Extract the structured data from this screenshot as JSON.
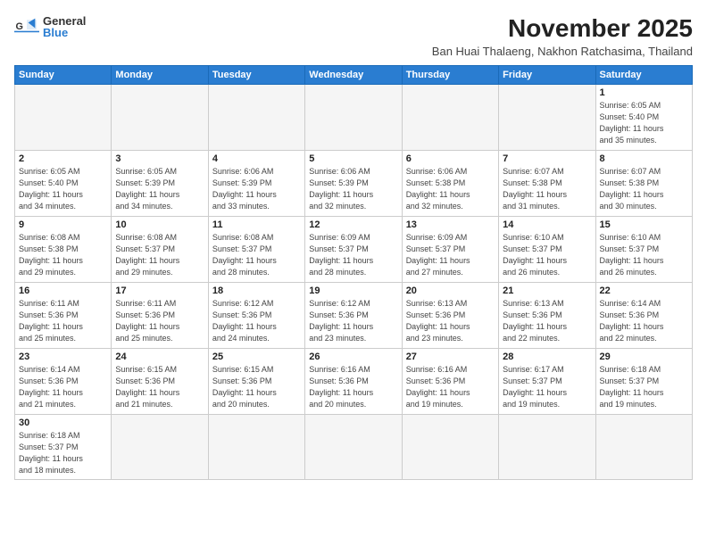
{
  "header": {
    "logo_general": "General",
    "logo_blue": "Blue",
    "month_title": "November 2025",
    "location": "Ban Huai Thalaeng, Nakhon Ratchasima, Thailand"
  },
  "days_of_week": [
    "Sunday",
    "Monday",
    "Tuesday",
    "Wednesday",
    "Thursday",
    "Friday",
    "Saturday"
  ],
  "weeks": [
    [
      {
        "day": "",
        "info": ""
      },
      {
        "day": "",
        "info": ""
      },
      {
        "day": "",
        "info": ""
      },
      {
        "day": "",
        "info": ""
      },
      {
        "day": "",
        "info": ""
      },
      {
        "day": "",
        "info": ""
      },
      {
        "day": "1",
        "info": "Sunrise: 6:05 AM\nSunset: 5:40 PM\nDaylight: 11 hours\nand 35 minutes."
      }
    ],
    [
      {
        "day": "2",
        "info": "Sunrise: 6:05 AM\nSunset: 5:40 PM\nDaylight: 11 hours\nand 34 minutes."
      },
      {
        "day": "3",
        "info": "Sunrise: 6:05 AM\nSunset: 5:39 PM\nDaylight: 11 hours\nand 34 minutes."
      },
      {
        "day": "4",
        "info": "Sunrise: 6:06 AM\nSunset: 5:39 PM\nDaylight: 11 hours\nand 33 minutes."
      },
      {
        "day": "5",
        "info": "Sunrise: 6:06 AM\nSunset: 5:39 PM\nDaylight: 11 hours\nand 32 minutes."
      },
      {
        "day": "6",
        "info": "Sunrise: 6:06 AM\nSunset: 5:38 PM\nDaylight: 11 hours\nand 32 minutes."
      },
      {
        "day": "7",
        "info": "Sunrise: 6:07 AM\nSunset: 5:38 PM\nDaylight: 11 hours\nand 31 minutes."
      },
      {
        "day": "8",
        "info": "Sunrise: 6:07 AM\nSunset: 5:38 PM\nDaylight: 11 hours\nand 30 minutes."
      }
    ],
    [
      {
        "day": "9",
        "info": "Sunrise: 6:08 AM\nSunset: 5:38 PM\nDaylight: 11 hours\nand 29 minutes."
      },
      {
        "day": "10",
        "info": "Sunrise: 6:08 AM\nSunset: 5:37 PM\nDaylight: 11 hours\nand 29 minutes."
      },
      {
        "day": "11",
        "info": "Sunrise: 6:08 AM\nSunset: 5:37 PM\nDaylight: 11 hours\nand 28 minutes."
      },
      {
        "day": "12",
        "info": "Sunrise: 6:09 AM\nSunset: 5:37 PM\nDaylight: 11 hours\nand 28 minutes."
      },
      {
        "day": "13",
        "info": "Sunrise: 6:09 AM\nSunset: 5:37 PM\nDaylight: 11 hours\nand 27 minutes."
      },
      {
        "day": "14",
        "info": "Sunrise: 6:10 AM\nSunset: 5:37 PM\nDaylight: 11 hours\nand 26 minutes."
      },
      {
        "day": "15",
        "info": "Sunrise: 6:10 AM\nSunset: 5:37 PM\nDaylight: 11 hours\nand 26 minutes."
      }
    ],
    [
      {
        "day": "16",
        "info": "Sunrise: 6:11 AM\nSunset: 5:36 PM\nDaylight: 11 hours\nand 25 minutes."
      },
      {
        "day": "17",
        "info": "Sunrise: 6:11 AM\nSunset: 5:36 PM\nDaylight: 11 hours\nand 25 minutes."
      },
      {
        "day": "18",
        "info": "Sunrise: 6:12 AM\nSunset: 5:36 PM\nDaylight: 11 hours\nand 24 minutes."
      },
      {
        "day": "19",
        "info": "Sunrise: 6:12 AM\nSunset: 5:36 PM\nDaylight: 11 hours\nand 23 minutes."
      },
      {
        "day": "20",
        "info": "Sunrise: 6:13 AM\nSunset: 5:36 PM\nDaylight: 11 hours\nand 23 minutes."
      },
      {
        "day": "21",
        "info": "Sunrise: 6:13 AM\nSunset: 5:36 PM\nDaylight: 11 hours\nand 22 minutes."
      },
      {
        "day": "22",
        "info": "Sunrise: 6:14 AM\nSunset: 5:36 PM\nDaylight: 11 hours\nand 22 minutes."
      }
    ],
    [
      {
        "day": "23",
        "info": "Sunrise: 6:14 AM\nSunset: 5:36 PM\nDaylight: 11 hours\nand 21 minutes."
      },
      {
        "day": "24",
        "info": "Sunrise: 6:15 AM\nSunset: 5:36 PM\nDaylight: 11 hours\nand 21 minutes."
      },
      {
        "day": "25",
        "info": "Sunrise: 6:15 AM\nSunset: 5:36 PM\nDaylight: 11 hours\nand 20 minutes."
      },
      {
        "day": "26",
        "info": "Sunrise: 6:16 AM\nSunset: 5:36 PM\nDaylight: 11 hours\nand 20 minutes."
      },
      {
        "day": "27",
        "info": "Sunrise: 6:16 AM\nSunset: 5:36 PM\nDaylight: 11 hours\nand 19 minutes."
      },
      {
        "day": "28",
        "info": "Sunrise: 6:17 AM\nSunset: 5:37 PM\nDaylight: 11 hours\nand 19 minutes."
      },
      {
        "day": "29",
        "info": "Sunrise: 6:18 AM\nSunset: 5:37 PM\nDaylight: 11 hours\nand 19 minutes."
      }
    ],
    [
      {
        "day": "30",
        "info": "Sunrise: 6:18 AM\nSunset: 5:37 PM\nDaylight: 11 hours\nand 18 minutes."
      },
      {
        "day": "",
        "info": ""
      },
      {
        "day": "",
        "info": ""
      },
      {
        "day": "",
        "info": ""
      },
      {
        "day": "",
        "info": ""
      },
      {
        "day": "",
        "info": ""
      },
      {
        "day": "",
        "info": ""
      }
    ]
  ]
}
